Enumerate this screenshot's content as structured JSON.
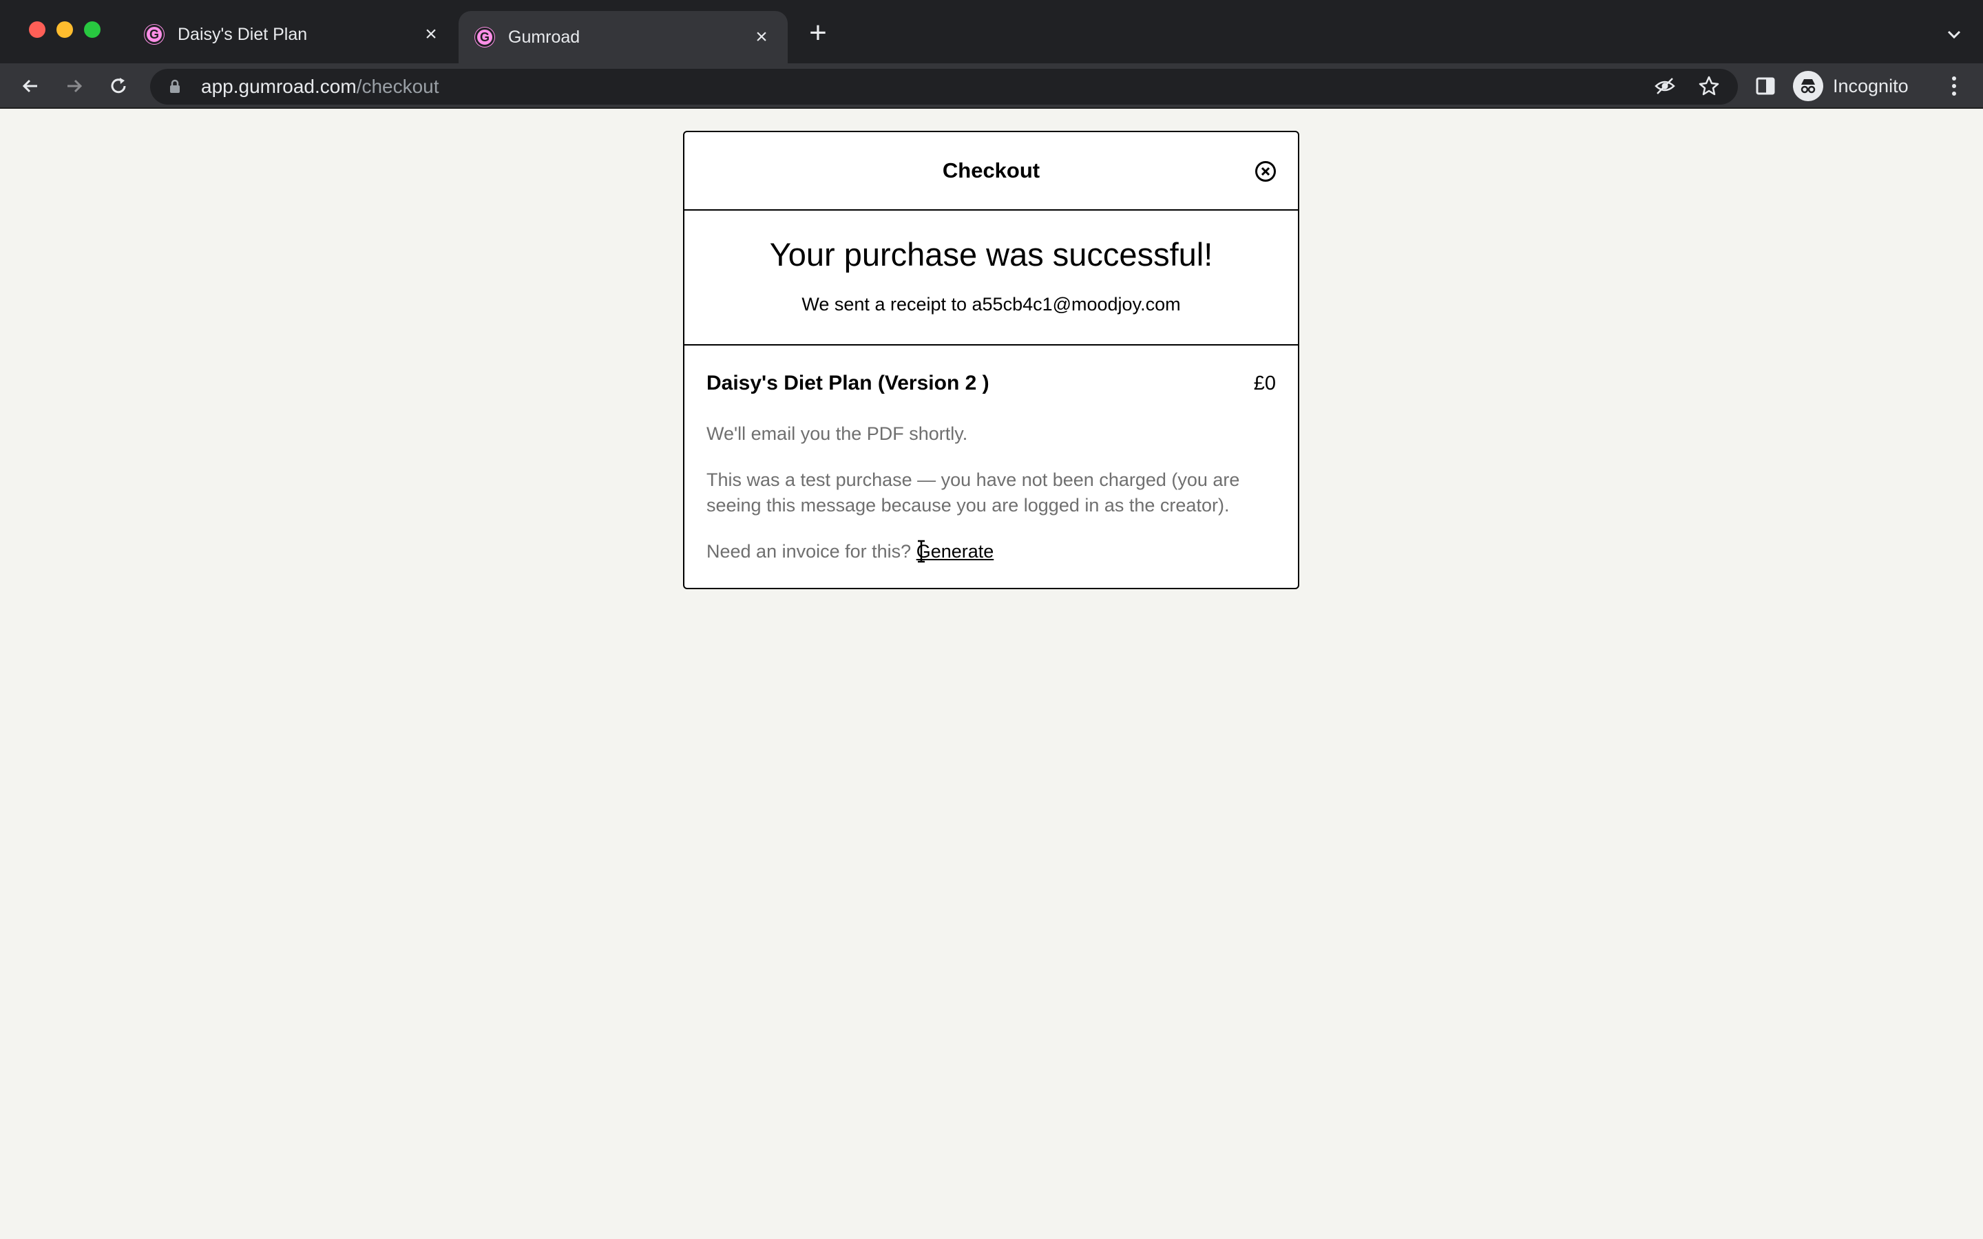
{
  "browser": {
    "tabs": [
      {
        "title": "Daisy's Diet Plan",
        "favicon": "gumroad-icon",
        "active": false
      },
      {
        "title": "Gumroad",
        "favicon": "gumroad-icon",
        "active": true
      }
    ],
    "url_host": "app.gumroad.com",
    "url_path": "/checkout",
    "profile_label": "Incognito"
  },
  "checkout": {
    "title": "Checkout",
    "headline": "Your purchase was successful!",
    "receipt_text": "We sent a receipt to a55cb4c1@moodjoy.com",
    "product_name": "Daisy's Diet Plan (Version 2 )",
    "price": "£0",
    "email_note": "We'll email you the PDF shortly.",
    "test_note": "This was a test purchase — you have not been charged (you are seeing this message because you are logged in as the creator).",
    "invoice_prompt": "Need an invoice for this?",
    "invoice_link": "Generate"
  },
  "colors": {
    "chrome_dark": "#202124",
    "chrome_toolbar": "#35363a",
    "page_bg": "#f4f4f0",
    "gumroad_pink": "#ff90e8"
  }
}
